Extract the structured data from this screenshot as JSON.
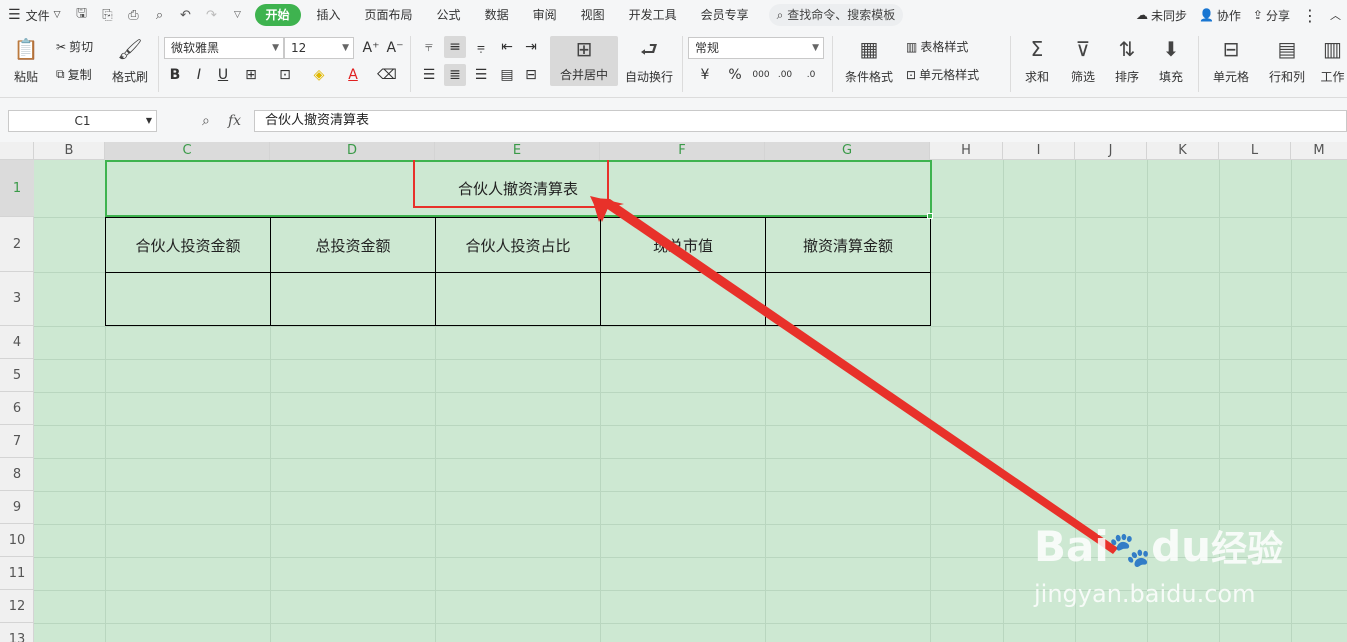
{
  "menubar": {
    "file_label": "文件",
    "tabs": [
      {
        "label": "开始",
        "active": true
      },
      {
        "label": "插入"
      },
      {
        "label": "页面布局"
      },
      {
        "label": "公式"
      },
      {
        "label": "数据"
      },
      {
        "label": "审阅"
      },
      {
        "label": "视图"
      },
      {
        "label": "开发工具"
      },
      {
        "label": "会员专享"
      }
    ],
    "search_label": "查找命令、搜索模板",
    "right": {
      "sync": "未同步",
      "collab": "协作",
      "share": "分享"
    }
  },
  "ribbon": {
    "paste": "粘贴",
    "cut": "剪切",
    "copy": "复制",
    "format_painter": "格式刷",
    "font_name": "微软雅黑",
    "font_size": "12",
    "merge_center": "合并居中",
    "auto_wrap": "自动换行",
    "number_format": "常规",
    "table_style": "表格样式",
    "conditional_format": "条件格式",
    "cell_style": "单元格样式",
    "sum": "求和",
    "filter": "筛选",
    "sort": "排序",
    "fill": "填充",
    "cells": "单元格",
    "rows_cols": "行和列",
    "worksheet": "工作"
  },
  "formula_bar": {
    "cell_ref": "C1",
    "fx_label": "fx",
    "content": "合伙人撤资清算表"
  },
  "columns": [
    "B",
    "C",
    "D",
    "E",
    "F",
    "G",
    "H",
    "I",
    "J",
    "K",
    "L",
    "M"
  ],
  "rows": [
    "1",
    "2",
    "3",
    "4",
    "5",
    "6",
    "7",
    "8",
    "9",
    "10",
    "11",
    "12",
    "13"
  ],
  "sheet": {
    "title": "合伙人撤资清算表",
    "headers": [
      "合伙人投资金额",
      "总投资金额",
      "合伙人投资占比",
      "现总市值",
      "撤资清算金额"
    ]
  },
  "watermark": {
    "brand": "Bai",
    "brand2": "du",
    "cn": "经验",
    "url": "jingyan.baidu.com"
  },
  "colors": {
    "accent": "#3eb34f",
    "sheet_bg": "#cde8d2",
    "annotation": "#e8312a"
  }
}
